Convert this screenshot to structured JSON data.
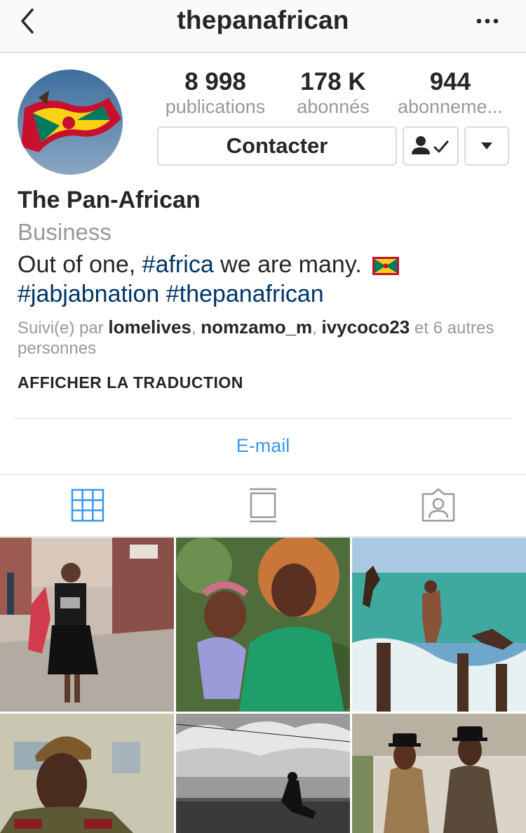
{
  "nav": {
    "title": "thepanafrican",
    "back_icon": "chevron-left-icon",
    "more_icon": "ellipsis-icon"
  },
  "profile": {
    "stats": [
      {
        "value": "8 998",
        "label": "publications"
      },
      {
        "value": "178 K",
        "label": "abonnés"
      },
      {
        "value": "944",
        "label": "abonneme..."
      }
    ],
    "contact_label": "Contacter",
    "follow_icon": "person-check-icon",
    "dropdown_icon": "caret-down-icon",
    "name": "The Pan-African",
    "category": "Business",
    "bio": {
      "line1_prefix": "Out of one, ",
      "tag1": "#africa",
      "line1_suffix": " we are many.",
      "tag2": "#jabjabnation",
      "tag3": "#thepanafrican"
    },
    "followed_by": {
      "prefix": "Suivi(e) par ",
      "users": [
        "lomelives",
        "nomzamo_m",
        "ivycoco23"
      ],
      "suffix": " et 6 autres personnes"
    },
    "translate_label": "AFFICHER LA TRADUCTION",
    "email_label": "E-mail"
  },
  "tabs": [
    {
      "name": "grid",
      "icon": "grid-icon",
      "active": true
    },
    {
      "name": "feed",
      "icon": "feed-icon",
      "active": false
    },
    {
      "name": "tagged",
      "icon": "tagged-person-icon",
      "active": false
    }
  ],
  "colors": {
    "link": "#003569",
    "accent": "#3897f0",
    "muted": "#999999",
    "text": "#262626"
  }
}
